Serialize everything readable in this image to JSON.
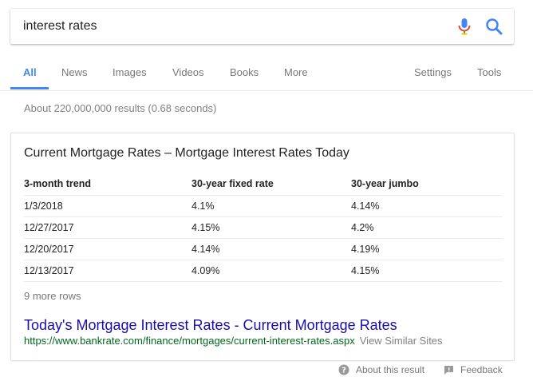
{
  "search": {
    "query": "interest rates"
  },
  "tabs": {
    "all": "All",
    "news": "News",
    "images": "Images",
    "videos": "Videos",
    "books": "Books",
    "more": "More",
    "settings": "Settings",
    "tools": "Tools"
  },
  "stats": "About 220,000,000 results (0.68 seconds)",
  "card": {
    "title": "Current Mortgage Rates – Mortgage Interest Rates Today",
    "headers": [
      "3-month trend",
      "30-year fixed rate",
      "30-year jumbo"
    ],
    "rows": [
      [
        "1/3/2018",
        "4.1%",
        "4.14%"
      ],
      [
        "12/27/2017",
        "4.15%",
        "4.2%"
      ],
      [
        "12/20/2017",
        "4.14%",
        "4.19%"
      ],
      [
        "12/13/2017",
        "4.09%",
        "4.15%"
      ]
    ],
    "more_rows": "9 more rows",
    "link_title": "Today's Mortgage Interest Rates - Current Mortgage Rates",
    "url": "https://www.bankrate.com/finance/mortgages/current-interest-rates.aspx",
    "similar": "View Similar Sites"
  },
  "footer": {
    "about": "About this result",
    "feedback": "Feedback"
  },
  "colors": {
    "accent": "#4285f4",
    "link": "#1a0dab",
    "url": "#006621",
    "muted": "#777777"
  },
  "icons": {
    "mic": "microphone-icon",
    "search": "search-icon",
    "help": "help-circle-icon",
    "feedback": "feedback-icon"
  }
}
